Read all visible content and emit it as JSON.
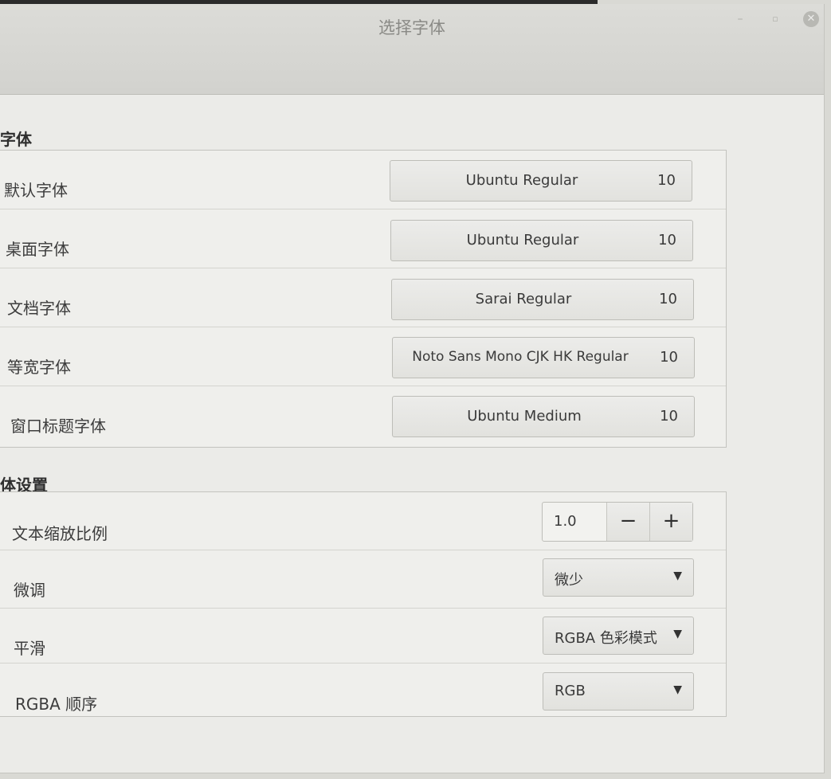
{
  "window": {
    "title": "选择字体",
    "minimize_glyph": "–",
    "maximize_glyph": "▫",
    "close_glyph": "✕"
  },
  "fonts_section": {
    "title": "字体",
    "rows": [
      {
        "label": "默认字体",
        "font": "Ubuntu Regular",
        "size": "10"
      },
      {
        "label": "桌面字体",
        "font": "Ubuntu Regular",
        "size": "10"
      },
      {
        "label": "文档字体",
        "font": "Sarai Regular",
        "size": "10"
      },
      {
        "label": "等宽字体",
        "font": "Noto Sans Mono CJK HK Regular",
        "size": "10"
      },
      {
        "label": "窗口标题字体",
        "font": "Ubuntu Medium",
        "size": "10"
      }
    ]
  },
  "text_settings": {
    "title": "体设置",
    "scale": {
      "label": "文本缩放比例",
      "value": "1.0",
      "minus": "−",
      "plus": "+"
    },
    "hinting": {
      "label": "微调",
      "value": "微少",
      "arrow": "▼"
    },
    "antialiasing": {
      "label": "平滑",
      "value": "RGBA 色彩模式",
      "arrow": "▼"
    },
    "rgba_order": {
      "label": "RGBA 顺序",
      "value": "RGB",
      "arrow": "▼"
    }
  }
}
